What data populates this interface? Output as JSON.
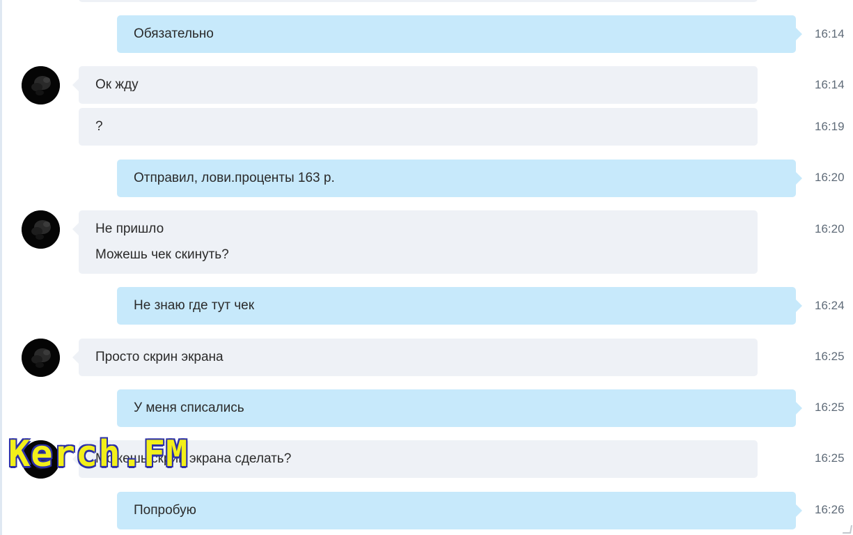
{
  "messages": [
    {
      "direction": "out",
      "text": "Обязательно",
      "time": "16:14"
    },
    {
      "direction": "in",
      "text": "Ок жду",
      "time": "16:14"
    },
    {
      "direction": "in",
      "text": "?",
      "time": "16:19"
    },
    {
      "direction": "out",
      "text": "Отправил, лови.проценты 163 р.",
      "time": "16:20"
    },
    {
      "direction": "in",
      "text": "Не пришло",
      "text2": "Можешь чек скинуть?",
      "time": "16:20"
    },
    {
      "direction": "out",
      "text": "Не знаю где тут чек",
      "time": "16:24"
    },
    {
      "direction": "in",
      "text": "Просто скрин экрана",
      "time": "16:25"
    },
    {
      "direction": "out",
      "text": "У меня списались",
      "time": "16:25"
    },
    {
      "direction": "in",
      "text": "Можешь скрин экрана сделать?",
      "time": "16:25"
    },
    {
      "direction": "out",
      "text": "Попробую",
      "time": "16:26"
    }
  ],
  "watermark": "Kerch.FM",
  "colors": {
    "incoming_bubble": "#eef1f6",
    "outgoing_bubble": "#c7e9fb",
    "watermark_fill": "#f2ef1a",
    "watermark_outline": "#2b2fa8"
  },
  "icons": {
    "avatar": "dark-dog-avatar-icon"
  }
}
